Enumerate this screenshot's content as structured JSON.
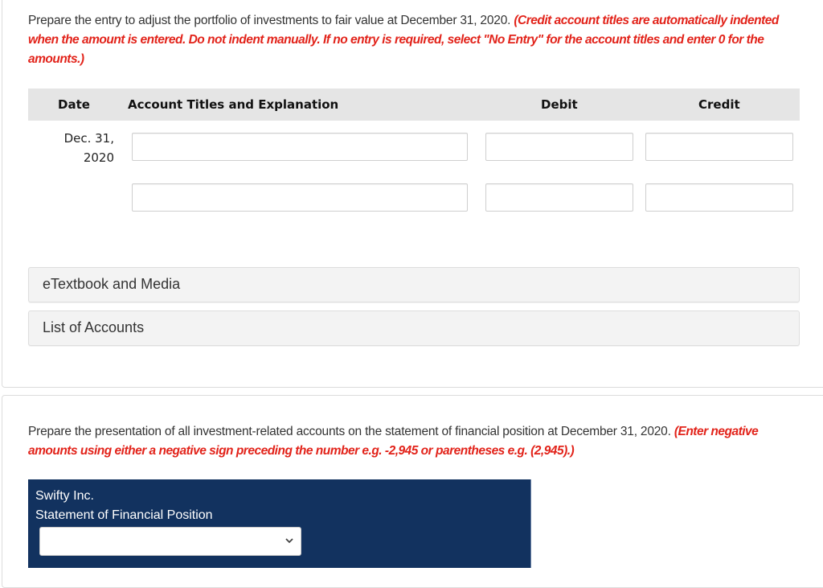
{
  "part_a": {
    "instruction_text": "Prepare the entry to adjust the portfolio of investments to fair value at December 31, 2020.",
    "instruction_note": "(Credit account titles are automatically indented when the amount is entered. Do not indent manually. If no entry is required, select \"No Entry\" for the account titles and enter 0 for the amounts.)",
    "journal": {
      "headers": {
        "date": "Date",
        "account": "Account Titles and Explanation",
        "debit": "Debit",
        "credit": "Credit"
      },
      "date_line1": "Dec. 31,",
      "date_line2": "2020",
      "rows": [
        {
          "account": "",
          "debit": "",
          "credit": ""
        },
        {
          "account": "",
          "debit": "",
          "credit": ""
        }
      ]
    },
    "resources": {
      "etextbook_label": "eTextbook and Media",
      "list_of_accounts_label": "List of Accounts"
    }
  },
  "part_b": {
    "instruction_text": "Prepare the presentation of all investment-related accounts on the statement of financial position at December 31, 2020.",
    "instruction_note": "(Enter negative amounts using either a negative sign preceding the number e.g. -2,945 or parentheses e.g. (2,945).)",
    "statement": {
      "company": "Swifty Inc.",
      "title": "Statement of Financial Position",
      "date_select_value": ""
    }
  },
  "colors": {
    "note_red": "#e2231a",
    "header_gray": "#e5e5e5",
    "statement_navy": "#12325f"
  }
}
